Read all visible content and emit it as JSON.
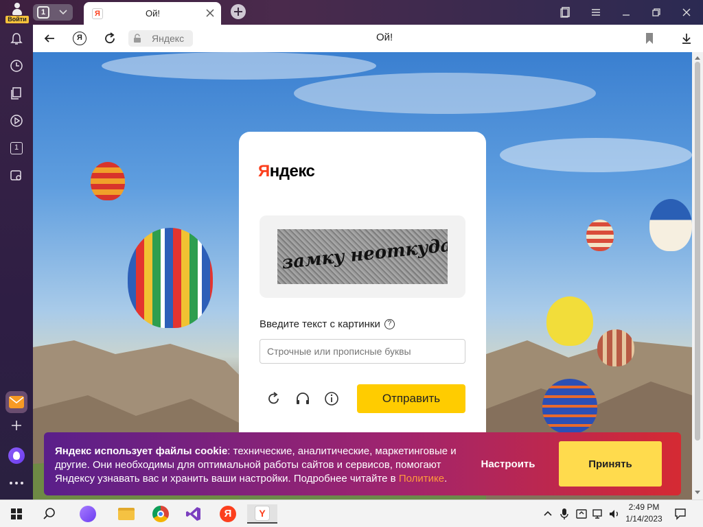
{
  "window": {
    "profile_label": "Войти",
    "tab_count": "1",
    "tab_title": "Ой!",
    "page_title": "Ой!",
    "address_text": "Яндекс"
  },
  "sidebar": {
    "items": [
      "notifications-icon",
      "history-icon",
      "collections-icon",
      "video-icon",
      "counter-icon",
      "screenshot-icon"
    ],
    "counter": "1"
  },
  "captcha": {
    "logo": "Яндекс",
    "captcha_text": "замку неоткуда",
    "prompt": "Введите текст с картинки",
    "help_symbol": "?",
    "placeholder": "Строчные или прописные буквы",
    "submit_label": "Отправить"
  },
  "cookie": {
    "bold": "Яндекс использует файлы cookie",
    "text": ": технические, аналитические, маркетинговые и другие. Они необходимы для оптимальной работы сайтов и сервисов, помогают Яндексу узнавать вас и хранить ваши настройки. Подробнее читайте в ",
    "link": "Политике",
    "after": ".",
    "configure_label": "Настроить",
    "accept_label": "Принять"
  },
  "taskbar": {
    "time": "2:49 PM",
    "date": "1/14/2023"
  },
  "colors": {
    "yandex_red": "#fc3f1d",
    "accept_yellow": "#ffdb4d",
    "link_orange": "#ff9a3c"
  }
}
